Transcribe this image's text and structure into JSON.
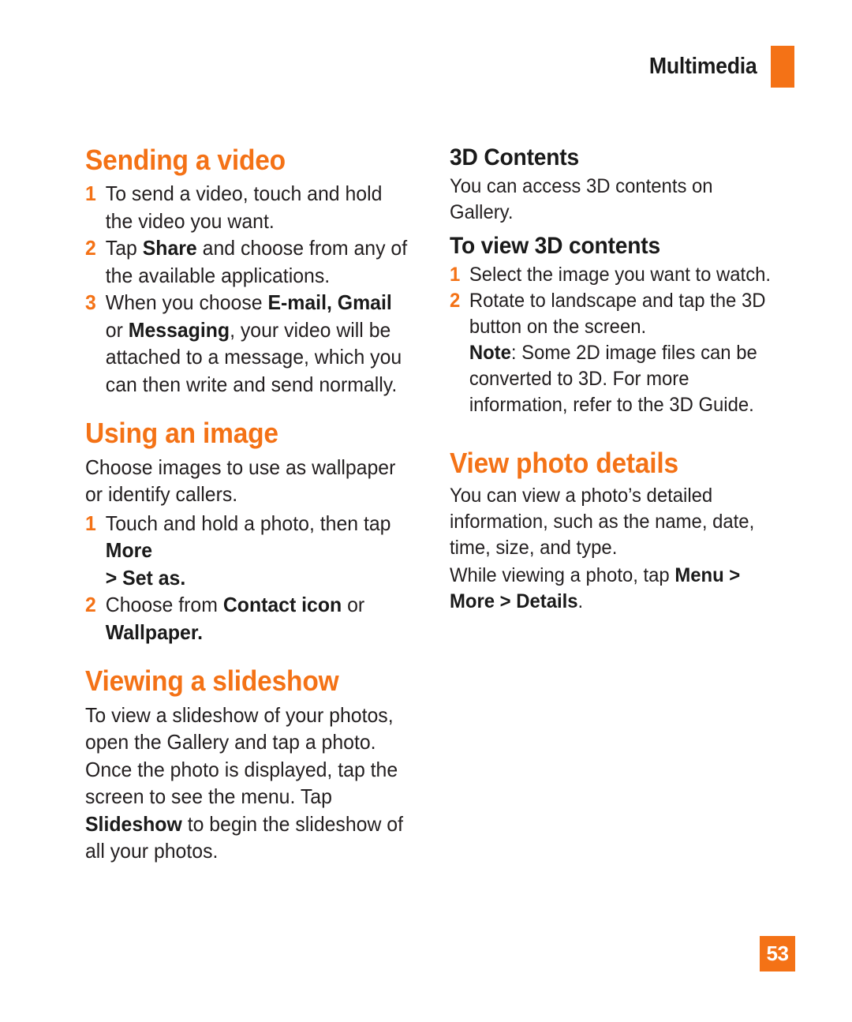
{
  "header": {
    "chapter": "Multimedia",
    "accent_color": "#F47216"
  },
  "folio": {
    "page_number": "53"
  },
  "left_column": {
    "sending_video": {
      "title": "Sending a video",
      "steps": [
        {
          "num": "1",
          "text_plain": "To send a video, touch and hold the video you want."
        },
        {
          "num": "2",
          "text_plain": "Tap Share and choose from any of the available applications."
        },
        {
          "num": "3",
          "text_plain": "When you choose E-mail, Gmail or Messaging, your video will be attached to a message, which you can then write and send normally."
        }
      ]
    },
    "using_image": {
      "title": "Using an image",
      "intro": "Choose images to use as wallpaper or identify callers.",
      "steps": [
        {
          "num": "1",
          "text_plain": "Touch and hold a photo, then tap More > Set as."
        },
        {
          "num": "2",
          "text_plain": "Choose from Contact icon or Wallpaper."
        }
      ]
    },
    "viewing_slideshow": {
      "title": "Viewing a slideshow",
      "body": "To view a slideshow of your photos, open the Gallery and tap a photo. Once the photo is displayed, tap the screen to see the menu. Tap Slideshow to begin the slideshow of all your photos."
    }
  },
  "right_column": {
    "three_d_contents": {
      "title": "3D Contents",
      "intro": "You can access 3D contents on Gallery.",
      "subtitle": "To view 3D contents",
      "steps": [
        {
          "num": "1",
          "text_plain": "Select the image you want to watch."
        },
        {
          "num": "2",
          "text_plain": "Rotate to landscape and tap the 3D button on the screen. Note: Some 2D image files can be converted to 3D. For more information, refer to the 3D Guide."
        }
      ],
      "note_label": "Note"
    },
    "view_photo_details": {
      "title": "View photo details",
      "body1": "You can view a photo’s detailed information, such as the name, date, time, size, and type.",
      "body2": "While viewing a photo, tap Menu > More > Details."
    }
  },
  "inline_bold_terms": [
    "Share",
    "E-mail, Gmail",
    "Messaging",
    "More",
    "> Set as.",
    "Contact icon",
    "Wallpaper.",
    "Slideshow",
    "Note",
    "Menu >",
    "More > Details"
  ]
}
